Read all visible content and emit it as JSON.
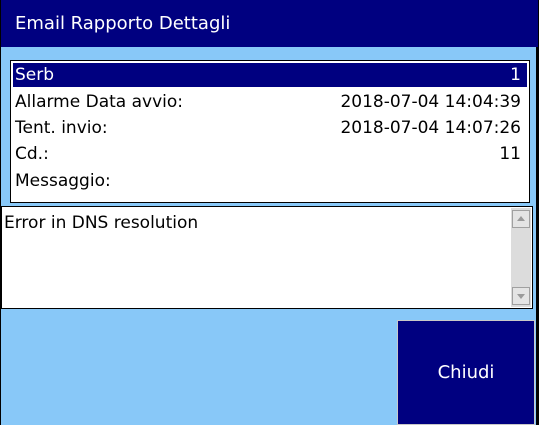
{
  "window": {
    "title": "Email Rapporto Dettagli"
  },
  "details": {
    "rows": [
      {
        "label": "Serb",
        "value": "1"
      },
      {
        "label": "Allarme Data avvio:",
        "value": "2018-07-04 14:04:39"
      },
      {
        "label": "Tent. invio:",
        "value": "2018-07-04 14:07:26"
      },
      {
        "label": "Cd.:",
        "value": "11"
      },
      {
        "label": "Messaggio:",
        "value": ""
      }
    ]
  },
  "message": {
    "text": "Error in DNS resolution"
  },
  "buttons": {
    "close_label": "Chiudi"
  },
  "colors": {
    "background": "#88c8f8",
    "titlebar": "#000080",
    "selected_row": "#000080",
    "button": "#000080"
  }
}
